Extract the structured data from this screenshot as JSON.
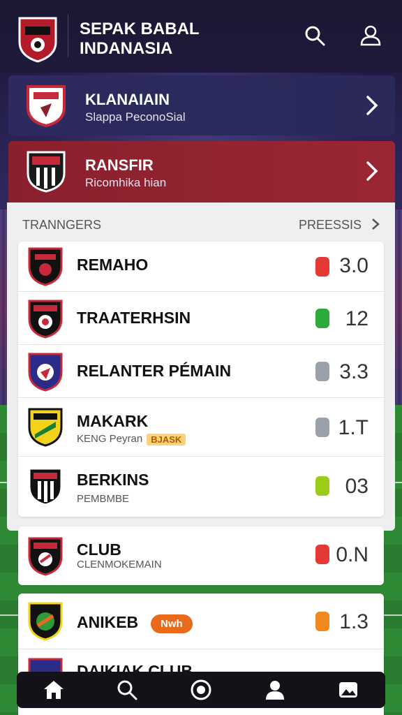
{
  "header": {
    "title_line1": "SEPAK BABAL",
    "title_line2": "INDANASIA",
    "search_icon": "search-icon",
    "profile_icon": "user-icon"
  },
  "banners": [
    {
      "title": "KLANAIAIN",
      "subtitle": "Slappa PeconoSial"
    },
    {
      "title": "RANSFIR",
      "subtitle": "Ricomhika hian"
    }
  ],
  "list": {
    "left_label": "TRANNGERS",
    "right_label": "PREESSIS",
    "rows": [
      {
        "name": "REMAHO",
        "subtitle": "",
        "tag": "",
        "score": "3.0",
        "stat_color": "#e53935"
      },
      {
        "name": "TRAATERHSIN",
        "subtitle": "",
        "tag": "",
        "score": "12",
        "stat_color": "#2eaa3d"
      },
      {
        "name": "RELANTER PÉMAIN",
        "subtitle": "",
        "tag": "",
        "score": "3.3",
        "stat_color": "#9aa1a8"
      },
      {
        "name": "MAKARK",
        "subtitle": "KENG Peyran",
        "tag": "BJASK",
        "score": "1.T",
        "stat_color": "#9aa1a8"
      },
      {
        "name": "BERKINS",
        "subtitle": "PEMBMBE",
        "tag": "",
        "score": "03",
        "stat_color": "#9ccc1a"
      }
    ]
  },
  "cards": [
    {
      "name": "CLUB",
      "subtitle": "CLENMOKEMAIN",
      "score": "0.N",
      "stat_color": "#e53935"
    },
    {
      "name": "ANIKEB",
      "pill": "Nwh",
      "score": "1.3",
      "stat_color": "#f08a1e"
    },
    {
      "name": "DAIKIAK CLUB"
    }
  ],
  "bottom_nav": [
    "home-icon",
    "search-icon",
    "record-icon",
    "user-icon",
    "gallery-icon"
  ]
}
